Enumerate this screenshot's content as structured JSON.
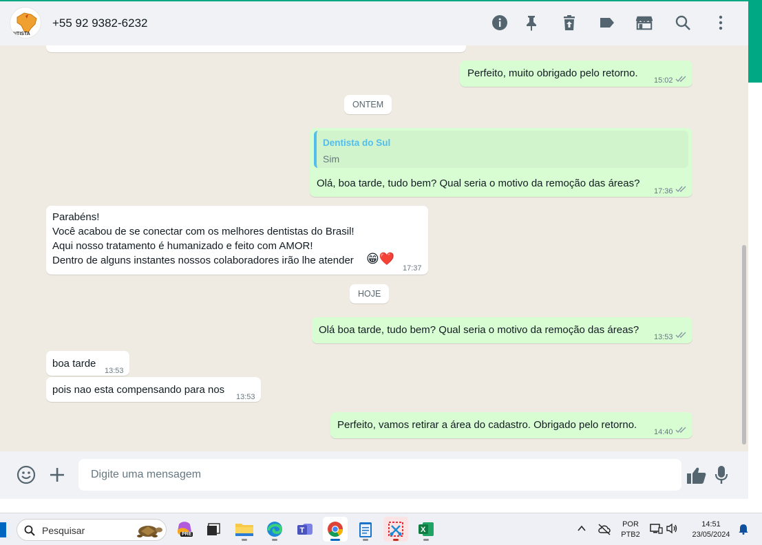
{
  "header": {
    "contact_name": "+55 92 9382-6232",
    "avatar_text": "NTISTA",
    "icons": [
      "info-icon",
      "pin-icon",
      "delete-icon",
      "label-icon",
      "store-icon",
      "search-icon",
      "menu-icon"
    ]
  },
  "messages": {
    "m1": {
      "text": "Perfeito, muito obrigado pelo retorno.",
      "time": "15:02"
    },
    "divider_yesterday": "ONTEM",
    "m2": {
      "quote_author": "Dentista do Sul",
      "quote_text": "Sim",
      "text": "Olá, boa tarde, tudo bem? Qual seria o motivo da remoção das áreas?",
      "time": "17:36"
    },
    "m3": {
      "line1": "Parabéns!",
      "line2": "Você acabou de se conectar com os melhores dentistas do Brasil!",
      "line3": "Aqui nosso tratamento é humanizado e feito com AMOR!",
      "line4": "Dentro de alguns instantes nossos colaboradores irão lhe atender",
      "emoji": "😁❤️",
      "time": "17:37"
    },
    "divider_today": "HOJE",
    "m4": {
      "text": "Olá boa tarde, tudo bem? Qual seria o motivo da remoção das áreas?",
      "time": "13:53"
    },
    "m5": {
      "text": "boa tarde",
      "time": "13:53"
    },
    "m6": {
      "text": "pois nao esta compensando para nos",
      "time": "13:53"
    },
    "m7": {
      "text": "Perfeito, vamos retirar a área do cadastro. Obrigado pelo retorno.",
      "time": "14:40"
    }
  },
  "composer": {
    "placeholder": "Digite uma mensagem"
  },
  "taskbar": {
    "search_label": "Pesquisar",
    "lang_line1": "POR",
    "lang_line2": "PTB2",
    "clock_time": "14:51",
    "clock_date": "23/05/2024",
    "copilot_badge": "PRE"
  },
  "colors": {
    "outgoing_bubble": "#d9fdd3",
    "incoming_bubble": "#ffffff",
    "chat_background": "#efeae2",
    "accent": "#00a884",
    "quote_author": "#53bdeb"
  }
}
